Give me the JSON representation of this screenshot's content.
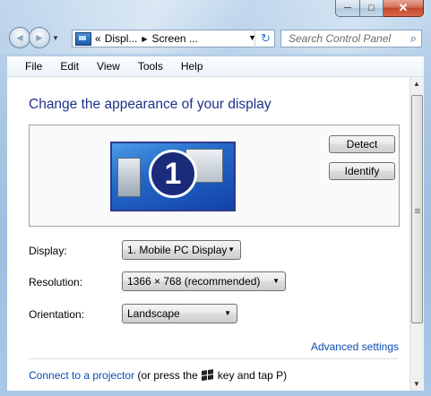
{
  "window": {
    "caption": {
      "minimize": "─",
      "maximize": "□",
      "close": "✕"
    }
  },
  "nav": {
    "back": "◄",
    "forward": "►",
    "dropdown": "▼",
    "address_segments": [
      "Displ...",
      "Screen ..."
    ],
    "address_prefix": "«",
    "address_separator": "▶",
    "refresh_glyph": "↻",
    "search_placeholder": "Search Control Panel"
  },
  "menu": [
    "File",
    "Edit",
    "View",
    "Tools",
    "Help"
  ],
  "main": {
    "title": "Change the appearance of your display",
    "monitor_number": "1",
    "detect_label": "Detect",
    "identify_label": "Identify",
    "display_label": "Display:",
    "display_value": "1. Mobile PC Display",
    "resolution_label": "Resolution:",
    "resolution_value": "1366 × 768 (recommended)",
    "orientation_label": "Orientation:",
    "orientation_value": "Landscape",
    "advanced_link": "Advanced settings",
    "projector_link": "Connect to a projector",
    "projector_text_a": " (or press the",
    "projector_text_b": "key and tap P)"
  },
  "colors": {
    "title": "#1e3287",
    "link": "#0a4db3",
    "close_button": "#c3472d"
  },
  "icons": [
    "control-panel-icon",
    "refresh-icon",
    "search-icon",
    "windows-key-icon",
    "monitor-icon"
  ]
}
